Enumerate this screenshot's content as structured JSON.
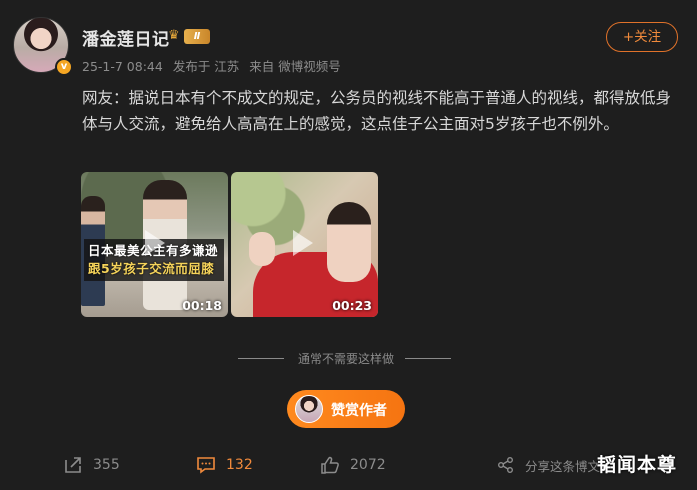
{
  "user": {
    "name": "潘金莲日记",
    "level": "Ⅱ",
    "follow_label": "+关注"
  },
  "meta": {
    "date": "25-1-7 08:44",
    "location": "发布于 江苏",
    "source": "来自 微博视频号"
  },
  "post": {
    "text": "网友：据说日本有个不成文的规定，公务员的视线不能高于普通人的视线，都得放低身体与人交流，避免给人高高在上的感觉，这点佳子公主面对5岁孩子也不例外。"
  },
  "videos": [
    {
      "caption_line1": "日本最美公主有多谦逊",
      "caption_line2": "跟5岁孩子交流而屈膝",
      "duration": "00:18"
    },
    {
      "duration": "00:23"
    }
  ],
  "divider_text": "通常不需要这样做",
  "reward_label": "赞赏作者",
  "actions": {
    "share_count": "355",
    "comment_count": "132",
    "like_count": "2072",
    "forward_label": "分享这条博文"
  },
  "watermark": "韬闻本尊",
  "colors": {
    "background": "#1e1e1e",
    "accent": "#f08a3c"
  }
}
